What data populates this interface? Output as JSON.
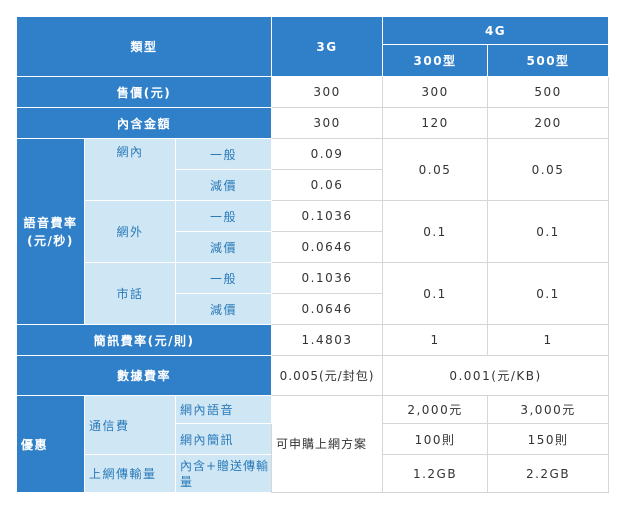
{
  "header": {
    "type_label": "類型",
    "g3": "3G",
    "g4": "4G",
    "plan300": "300型",
    "plan500": "500型"
  },
  "rows": {
    "price": {
      "label": "售價(元)",
      "g3": "300",
      "p300": "300",
      "p500": "500"
    },
    "included": {
      "label": "內含金額",
      "g3": "300",
      "p300": "120",
      "p500": "200"
    },
    "voice": {
      "label": "語音費率\n(元/秒)",
      "general": "一般",
      "discount": "減價",
      "onnet": {
        "label": "網內",
        "g3_general": "0.09",
        "g3_discount": "0.06",
        "p300": "0.05",
        "p500": "0.05"
      },
      "offnet": {
        "label": "網外",
        "g3_general": "0.1036",
        "g3_discount": "0.0646",
        "p300": "0.1",
        "p500": "0.1"
      },
      "landline": {
        "label": "市話",
        "g3_general": "0.1036",
        "g3_discount": "0.0646",
        "p300": "0.1",
        "p500": "0.1"
      }
    },
    "sms": {
      "label": "簡訊費率(元/則)",
      "g3": "1.4803",
      "p300": "1",
      "p500": "1"
    },
    "data": {
      "label": "數據費率",
      "g3": "0.005(元/封包)",
      "g4": "0.001(元/KB)"
    },
    "offer": {
      "label": "優惠",
      "call_fee": "通信費",
      "onnet_voice": "網內語音",
      "onnet_sms": "網內簡訊",
      "upload": "上網傳輸量",
      "upload_desc": "內含+贈送傳輸量",
      "g3": "可申購上網方案",
      "voice_p300": "2,000元",
      "voice_p500": "3,000元",
      "sms_p300": "100則",
      "sms_p500": "150則",
      "data_p300": "1.2GB",
      "data_p500": "2.2GB"
    }
  },
  "colors": {
    "header": "#2f80c9",
    "sub": "#cfe6f5",
    "sub_text": "#2a7ab8",
    "border": "#d6d6d6"
  }
}
